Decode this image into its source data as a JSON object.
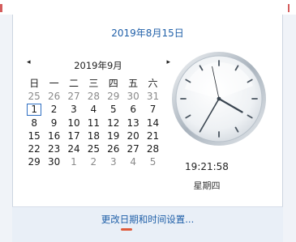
{
  "header": {
    "date_link": "2019年8月15日"
  },
  "calendar": {
    "month_label": "2019年9月",
    "prev_icon": "◂",
    "next_icon": "▸",
    "weekdays": [
      "日",
      "一",
      "二",
      "三",
      "四",
      "五",
      "六"
    ],
    "rows": [
      [
        "25",
        "26",
        "27",
        "28",
        "29",
        "30",
        "31"
      ],
      [
        "1",
        "2",
        "3",
        "4",
        "5",
        "6",
        "7"
      ],
      [
        "8",
        "9",
        "10",
        "11",
        "12",
        "13",
        "14"
      ],
      [
        "15",
        "16",
        "17",
        "18",
        "19",
        "20",
        "21"
      ],
      [
        "22",
        "23",
        "24",
        "25",
        "26",
        "27",
        "28"
      ],
      [
        "29",
        "30",
        "1",
        "2",
        "3",
        "4",
        "5"
      ]
    ]
  },
  "clock": {
    "time": "19:21:58",
    "weekday": "星期四"
  },
  "footer": {
    "settings_link": "更改日期和时间设置..."
  },
  "colors": {
    "link": "#1f5fa8",
    "today_border": "#2f6fc2"
  }
}
